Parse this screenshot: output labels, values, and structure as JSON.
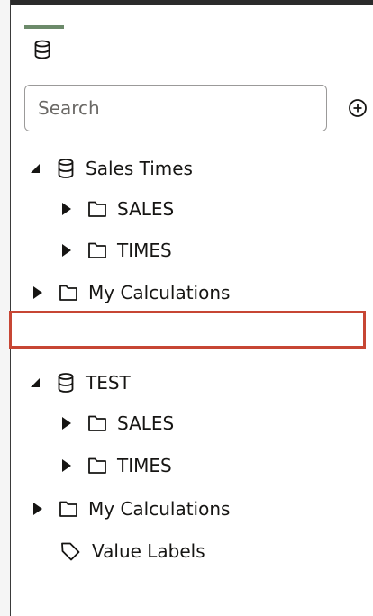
{
  "search": {
    "placeholder": "Search",
    "value": ""
  },
  "tree": {
    "group1": {
      "label": "Sales Times",
      "children": [
        "SALES",
        "TIMES"
      ],
      "calculations": "My Calculations"
    },
    "group2": {
      "label": "TEST",
      "children": [
        "SALES",
        "TIMES"
      ],
      "calculations": "My Calculations",
      "value_labels": "Value Labels"
    }
  },
  "colors": {
    "accent_indicator": "#6c8a6a",
    "highlight_border": "#c74634",
    "text": "#161513"
  },
  "icons": {
    "tab": "database-icon",
    "add": "add-circle-icon",
    "expanded": "triangle-down-icon",
    "collapsed": "triangle-right-icon",
    "folder": "folder-icon",
    "tag": "tag-icon"
  }
}
